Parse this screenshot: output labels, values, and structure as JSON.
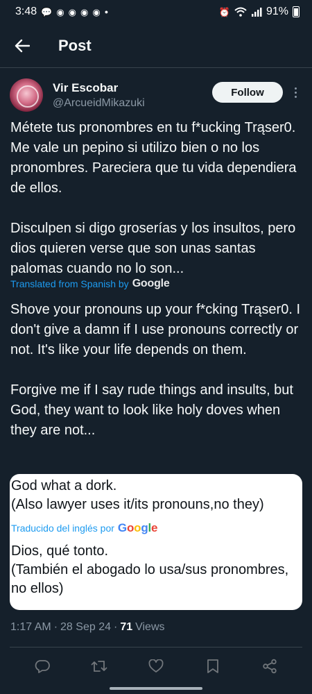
{
  "status_bar": {
    "time": "3:48",
    "battery": "91%"
  },
  "header": {
    "title": "Post"
  },
  "author": {
    "display_name": "Vir Escobar",
    "handle": "@ArcueidMikazuki",
    "follow_label": "Follow"
  },
  "post": {
    "original_text": "Métete tus pronombres en tu f*ucking Trąser0. Me vale un pepino si utilizo bien o no los pronombres. Pareciera que tu vida dependiera de ellos.\n\nDisculpen si digo groserías y los insultos, pero dios quieren verse que son unas santas palomas cuando no lo son...",
    "translated_label": "Translated from Spanish by",
    "translated_brand": "Google",
    "translated_text": "Shove your pronouns up your f*cking Trąser0. I don't give a damn if I use pronouns correctly or not. It's like your life depends on them.\n\nForgive me if I say rude things and insults, but God, they want to look like holy doves when they are not..."
  },
  "note_card": {
    "original_text": "God what a dork.\n(Also lawyer uses it/its pronouns,no they)",
    "translated_label": "Traducido del inglés por",
    "translated_brand": "Google",
    "translated_text": "Dios, qué tonto.\n(También el abogado lo usa/sus pronombres, no ellos)"
  },
  "meta": {
    "time": "1:17 AM",
    "date": "28 Sep 24",
    "views_count": "71",
    "views_label": "Views",
    "separator": "·"
  },
  "actions": {
    "reply": "reply-icon",
    "repost": "repost-icon",
    "like": "heart-icon",
    "bookmark": "bookmark-icon",
    "share": "share-icon"
  },
  "colors": {
    "background": "#15202b",
    "accent": "#1d9bf0",
    "muted": "#8b98a5"
  }
}
